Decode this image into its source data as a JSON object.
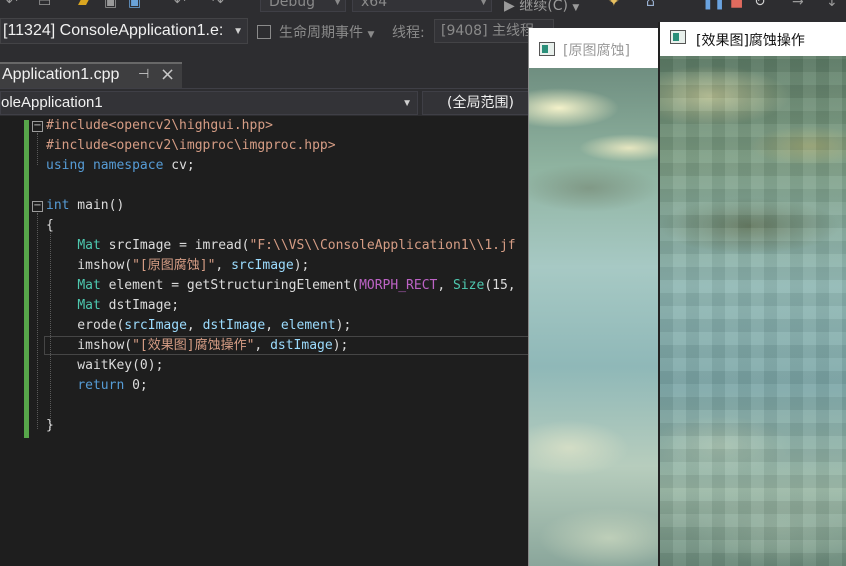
{
  "toolbar": {
    "config_combo": "Debug",
    "platform_combo": "x64",
    "continue_label": "继续(C)"
  },
  "debug_bar": {
    "process": "[11324] ConsoleApplication1.e:",
    "lifecycle_label": "生命周期事件",
    "thread_label": "线程:",
    "thread_value": "[9408] 主线程"
  },
  "editor": {
    "tab_title": "Application1.cpp",
    "project_combo": "oleApplication1",
    "scope_combo": "(全局范围)",
    "code_lines": [
      {
        "segments": [
          {
            "t": "#include<opencv2\\highgui.hpp>",
            "c": "str"
          }
        ]
      },
      {
        "segments": [
          {
            "t": "#include<opencv2\\imgproc\\imgproc.hpp>",
            "c": "str"
          }
        ]
      },
      {
        "segments": [
          {
            "t": "using",
            "c": "kw"
          },
          {
            "t": " ",
            "c": ""
          },
          {
            "t": "namespace",
            "c": "kw"
          },
          {
            "t": " cv;",
            "c": ""
          }
        ]
      },
      {
        "segments": []
      },
      {
        "segments": [
          {
            "t": "int",
            "c": "kw"
          },
          {
            "t": " main()",
            "c": ""
          }
        ]
      },
      {
        "segments": [
          {
            "t": "{",
            "c": ""
          }
        ]
      },
      {
        "segments": [
          {
            "t": "    ",
            "c": ""
          },
          {
            "t": "Mat",
            "c": "ty"
          },
          {
            "t": " srcImage = imread(",
            "c": ""
          },
          {
            "t": "\"F:\\\\VS\\\\ConsoleApplication1\\\\1.jf",
            "c": "str"
          }
        ]
      },
      {
        "segments": [
          {
            "t": "    imshow(",
            "c": ""
          },
          {
            "t": "\"[原图腐蚀]\"",
            "c": "str"
          },
          {
            "t": ", ",
            "c": ""
          },
          {
            "t": "srcImage",
            "c": "var"
          },
          {
            "t": ");",
            "c": ""
          }
        ]
      },
      {
        "segments": [
          {
            "t": "    ",
            "c": ""
          },
          {
            "t": "Mat",
            "c": "ty"
          },
          {
            "t": " element = getStructuringElement(",
            "c": ""
          },
          {
            "t": "MORPH_RECT",
            "c": "mac"
          },
          {
            "t": ", ",
            "c": ""
          },
          {
            "t": "Size",
            "c": "ty"
          },
          {
            "t": "(15,",
            "c": ""
          }
        ]
      },
      {
        "segments": [
          {
            "t": "    ",
            "c": ""
          },
          {
            "t": "Mat",
            "c": "ty"
          },
          {
            "t": " dstImage;",
            "c": ""
          }
        ]
      },
      {
        "segments": [
          {
            "t": "    erode(",
            "c": ""
          },
          {
            "t": "srcImage",
            "c": "var"
          },
          {
            "t": ", ",
            "c": ""
          },
          {
            "t": "dstImage",
            "c": "var"
          },
          {
            "t": ", ",
            "c": ""
          },
          {
            "t": "element",
            "c": "var"
          },
          {
            "t": ");",
            "c": ""
          }
        ]
      },
      {
        "segments": [
          {
            "t": "    imshow(",
            "c": ""
          },
          {
            "t": "\"[效果图]腐蚀操作\"",
            "c": "str"
          },
          {
            "t": ", ",
            "c": ""
          },
          {
            "t": "dstImage",
            "c": "var"
          },
          {
            "t": ");",
            "c": ""
          }
        ]
      },
      {
        "segments": [
          {
            "t": "    waitKey(0);",
            "c": ""
          }
        ]
      },
      {
        "segments": [
          {
            "t": "    ",
            "c": ""
          },
          {
            "t": "return",
            "c": "kw"
          },
          {
            "t": " 0;",
            "c": ""
          }
        ]
      },
      {
        "segments": []
      },
      {
        "segments": [
          {
            "t": "}",
            "c": ""
          }
        ]
      }
    ]
  },
  "windows": {
    "original_title": "[原图腐蚀]",
    "result_title": "[效果图]腐蚀操作"
  },
  "icons": {
    "pin": "pin-icon",
    "close": "close-icon",
    "fold": "collapse-icon",
    "window": "opencv-window-icon"
  },
  "colors": {
    "editor_bg": "#1e1e1e",
    "keyword": "#569cd6",
    "type": "#4ec9b0",
    "string": "#d69d85",
    "variable": "#9cdcfe",
    "macro": "#bd63c5",
    "change_bar": "#57a64a"
  }
}
